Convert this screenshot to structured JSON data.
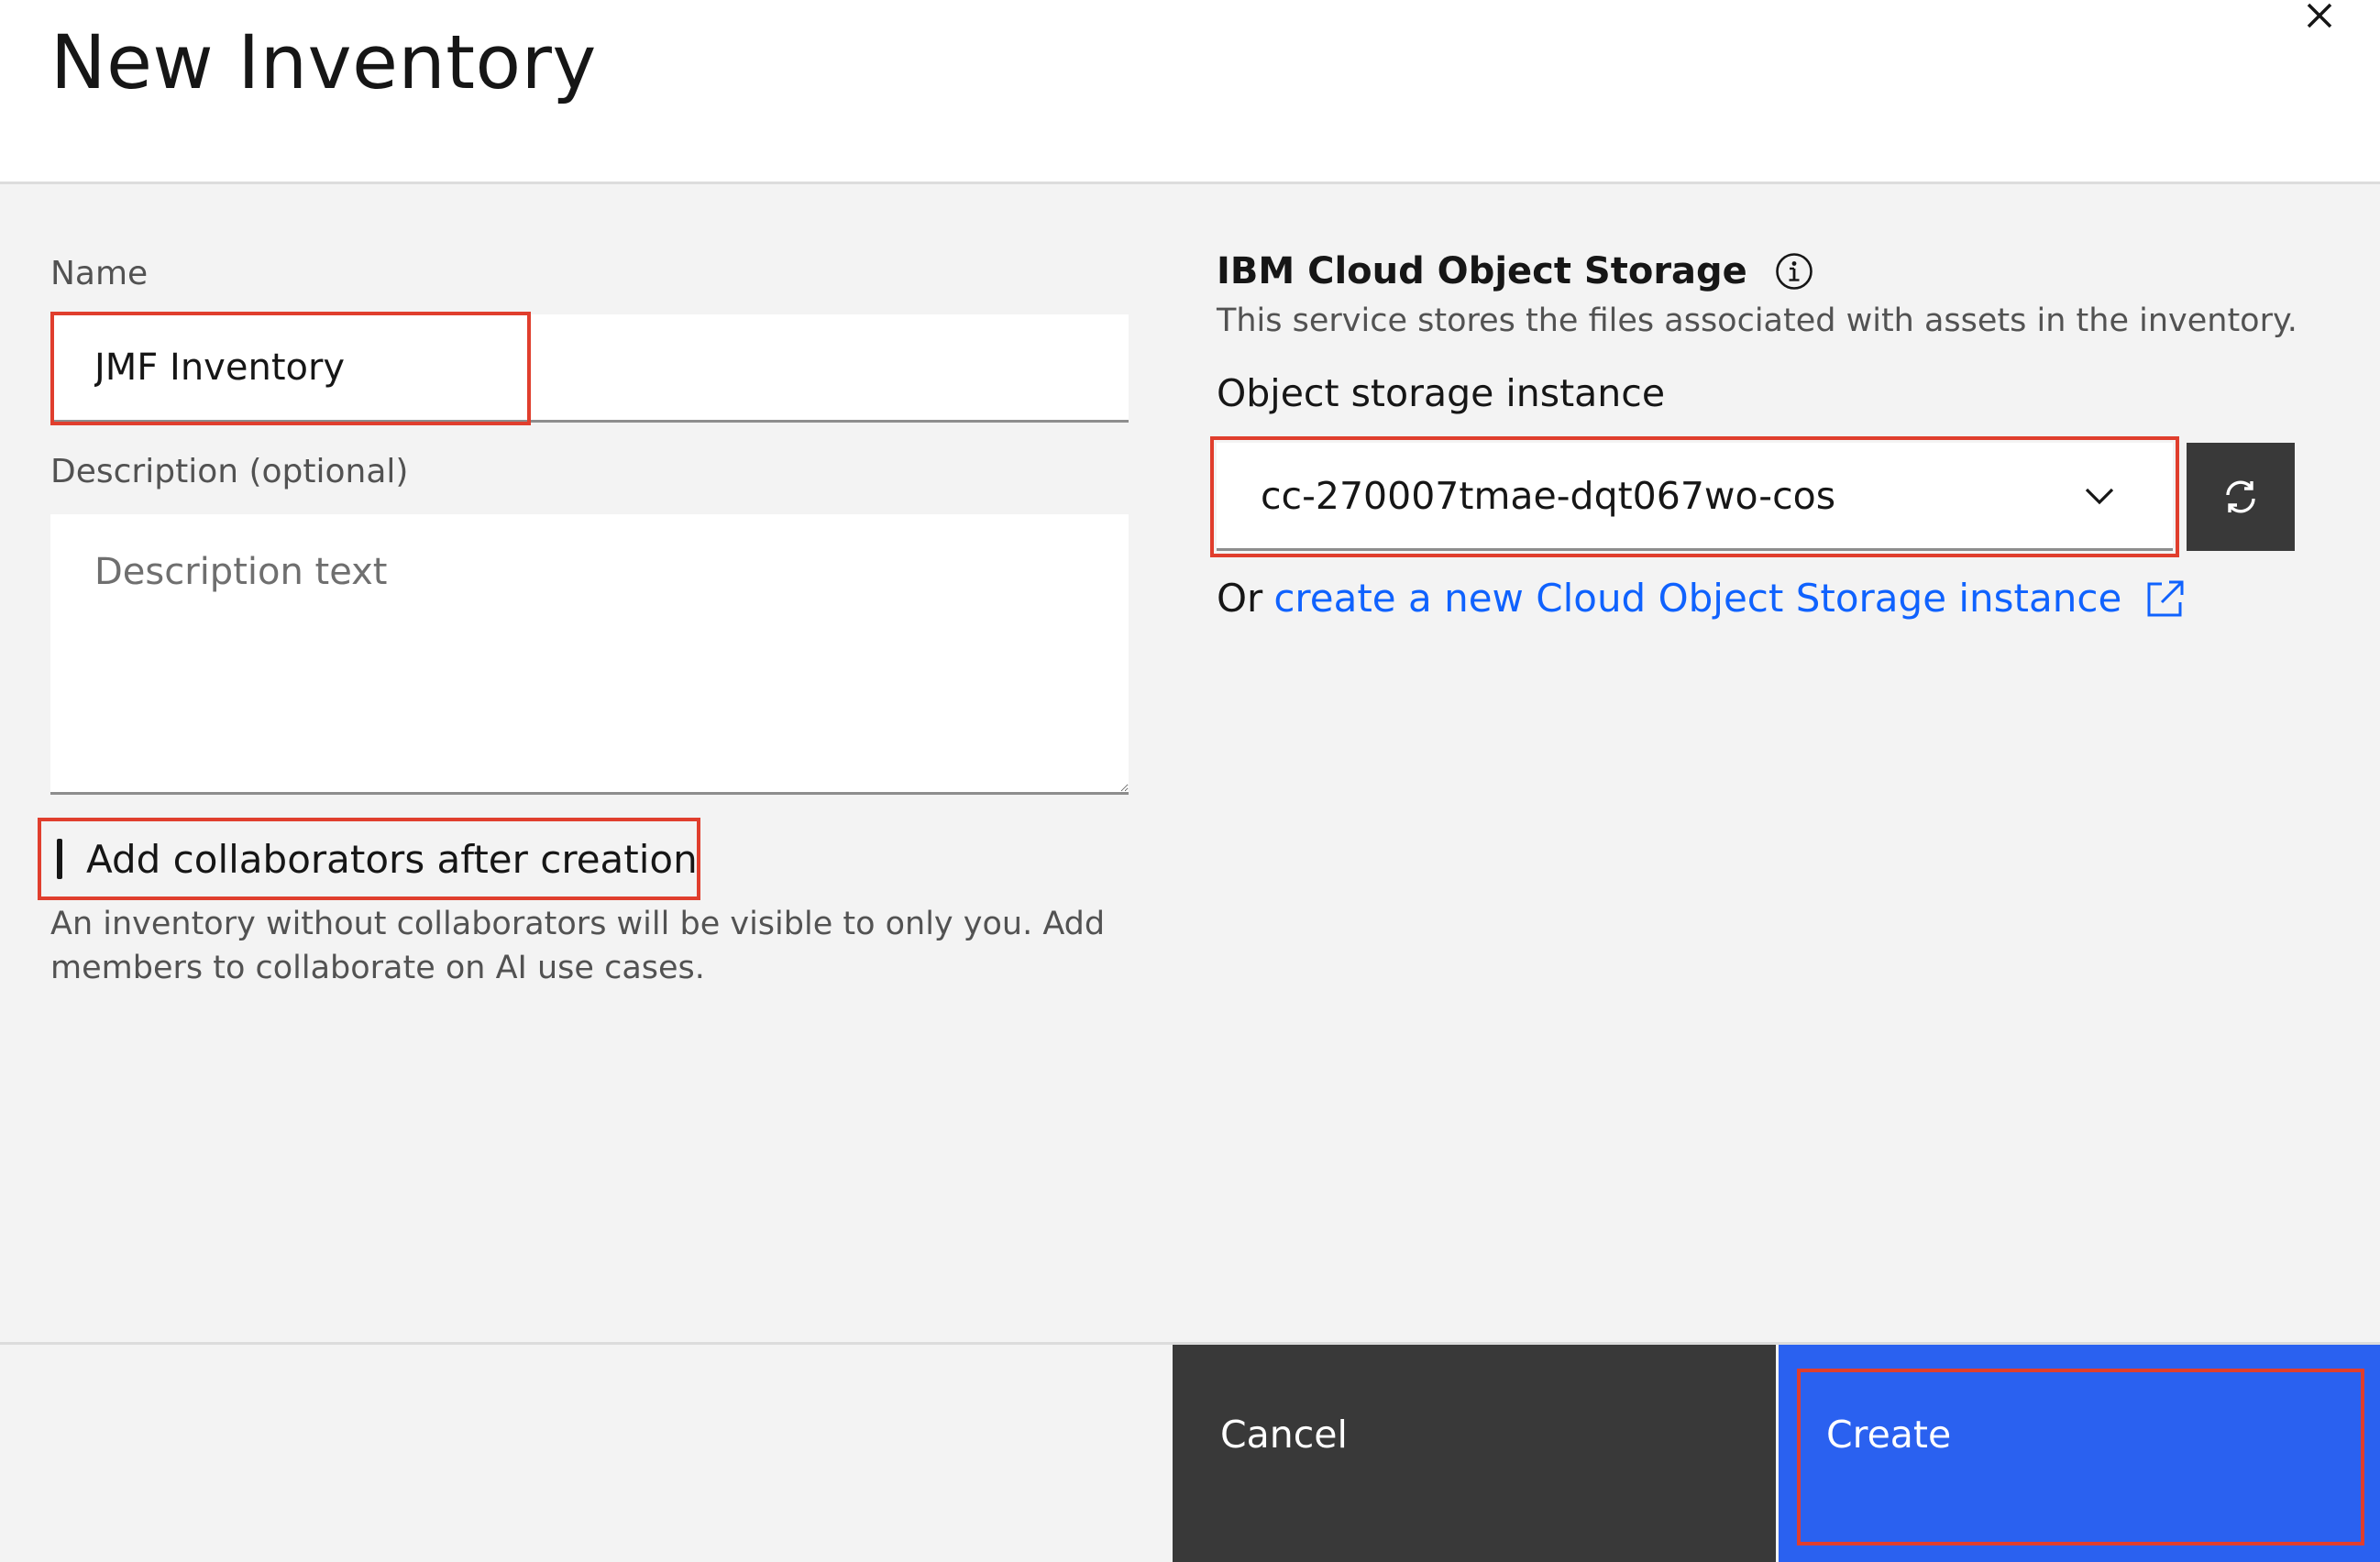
{
  "dialog": {
    "title": "New Inventory",
    "close_icon": "close-icon"
  },
  "form": {
    "name": {
      "label": "Name",
      "value": "JMF Inventory"
    },
    "description": {
      "label": "Description (optional)",
      "placeholder": "Description text",
      "value": ""
    },
    "collaborators": {
      "label": "Add collaborators after creation",
      "checked": false,
      "helper": "An inventory without collaborators will be visible to only you. Add members to collaborate on AI use cases."
    }
  },
  "storage": {
    "title": "IBM Cloud Object Storage",
    "info_icon": "info-icon",
    "description": "This service stores the files associated with assets in the inventory.",
    "instance_label": "Object storage instance",
    "selected_instance": "cc-270007tmae-dqt067wo-cos",
    "dropdown_icon": "chevron-down-icon",
    "refresh_icon": "refresh-icon",
    "or_text": "Or",
    "create_link": "create a new Cloud Object Storage instance",
    "external_icon": "launch-icon"
  },
  "footer": {
    "cancel_label": "Cancel",
    "create_label": "Create"
  },
  "colors": {
    "primary": "#2a61f0",
    "secondary": "#393939",
    "link": "#0f62fe",
    "highlight": "#e03e2d",
    "background": "#f3f3f3"
  }
}
